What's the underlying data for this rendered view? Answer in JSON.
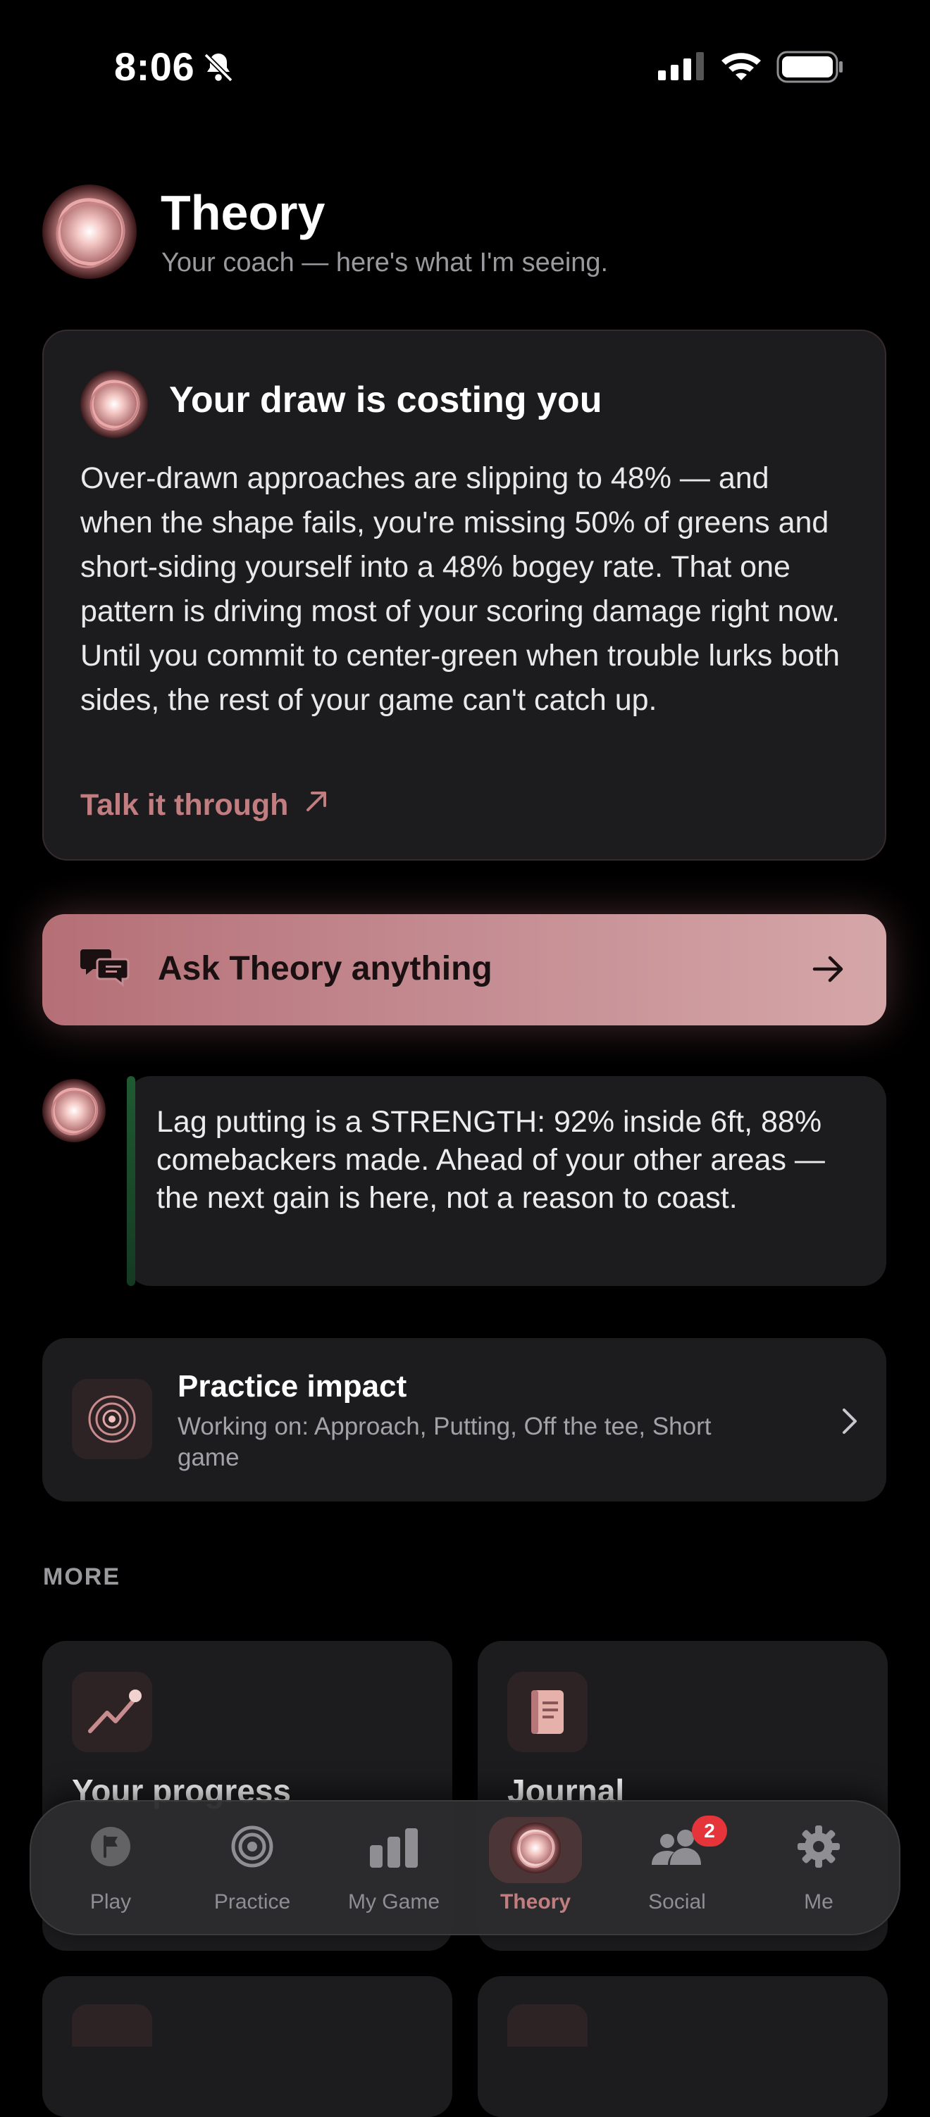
{
  "status_bar": {
    "time": "8:06"
  },
  "header": {
    "title": "Theory",
    "subtitle": "Your coach — here's what I'm seeing."
  },
  "insight": {
    "title": "Your draw is costing you",
    "body": "Over-drawn approaches are slipping to 48% — and when the shape fails, you're missing 50% of greens and short-siding yourself into a 48% bogey rate. That one pattern is driving most of your scoring damage right now. Until you commit to center-green when trouble lurks both sides, the rest of your game can't catch up.",
    "link_label": "Talk it through"
  },
  "ask": {
    "label": "Ask Theory anything"
  },
  "strength": {
    "text": "Lag putting is a STRENGTH: 92% inside 6ft, 88% comebackers made. Ahead of your other areas — the next gain is here, not a reason to coast."
  },
  "practice_impact": {
    "title": "Practice impact",
    "subtitle": "Working on: Approach, Putting, Off the tee, Short game"
  },
  "more": {
    "label": "MORE",
    "cards": [
      {
        "title": "Your progress"
      },
      {
        "title": "Journal"
      }
    ]
  },
  "tabs": [
    {
      "label": "Play"
    },
    {
      "label": "Practice"
    },
    {
      "label": "My Game"
    },
    {
      "label": "Theory"
    },
    {
      "label": "Social",
      "badge": "2"
    },
    {
      "label": "Me"
    }
  ],
  "colors": {
    "accent": "#c17d80",
    "card": "#1c1c1e",
    "badge": "#e5353a"
  }
}
